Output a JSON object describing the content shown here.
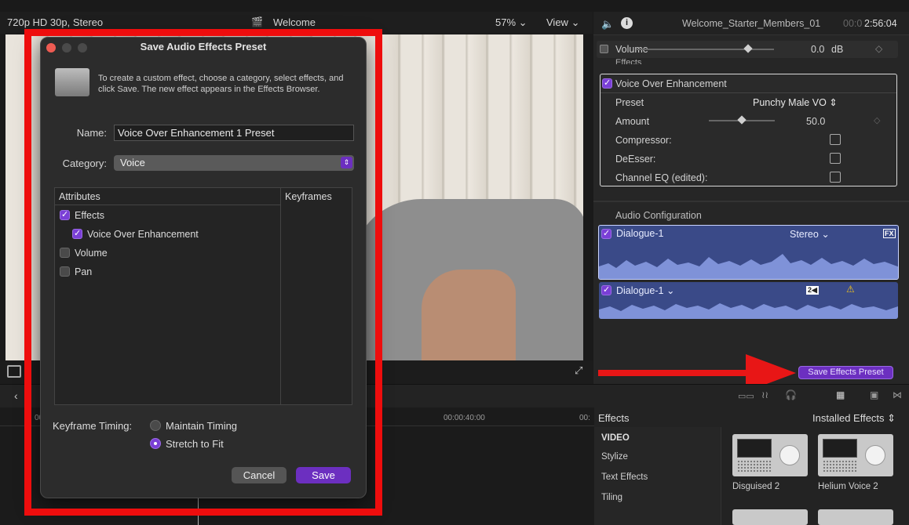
{
  "viewer": {
    "format": "720p HD 30p, Stereo",
    "title": "Welcome",
    "zoom": "57%",
    "view_menu": "View"
  },
  "inspector": {
    "clip_name": "Welcome_Starter_Members_01",
    "timecode_dim": "00:0",
    "timecode": "2:56:04",
    "volume_label": "Volume",
    "volume_value": "0.0",
    "volume_unit": "dB",
    "effects_header": "Effects",
    "effect_name": "Voice Over Enhancement",
    "preset_label": "Preset",
    "preset_value": "Punchy Male VO",
    "amount_label": "Amount",
    "amount_value": "50.0",
    "amount_level": 0.5,
    "compressor_label": "Compressor:",
    "deesser_label": "DeEsser:",
    "channel_eq_label": "Channel EQ (edited):",
    "audio_config_label": "Audio Configuration",
    "clip1_name": "Dialogue-1",
    "clip1_mode": "Stereo",
    "clip1_badge": "FX",
    "clip2_name": "Dialogue-1",
    "clip2_badge": "2◀",
    "warning_icon": "warning-icon",
    "save_preset_button": "Save Effects Preset"
  },
  "timeline": {
    "ruler_time_1": "00:",
    "ruler_time_2": "00:00:40:00",
    "ruler_time_3": "00:"
  },
  "effects_browser": {
    "title": "Effects",
    "installed_label": "Installed Effects",
    "category_header": "VIDEO",
    "categories": [
      "Stylize",
      "Text Effects",
      "Tiling"
    ],
    "thumbs": [
      "Disguised 2",
      "Helium Voice 2"
    ]
  },
  "dialog": {
    "title": "Save Audio Effects Preset",
    "description": "To create a custom effect, choose a category, select effects, and click Save. The new effect appears in the Effects Browser.",
    "name_label": "Name:",
    "name_value": "Voice Over Enhancement 1 Preset",
    "category_label": "Category:",
    "category_value": "Voice",
    "attributes_header": "Attributes",
    "keyframes_header": "Keyframes",
    "attributes": [
      {
        "label": "Effects",
        "checked": true
      },
      {
        "label": "Voice Over Enhancement",
        "checked": true
      },
      {
        "label": "Volume",
        "checked": false
      },
      {
        "label": "Pan",
        "checked": false
      }
    ],
    "keyframe_timing_label": "Keyframe Timing:",
    "maintain_timing": "Maintain Timing",
    "stretch_to_fit": "Stretch to Fit",
    "cancel_label": "Cancel",
    "save_label": "Save"
  },
  "colors": {
    "accent_purple": "#6c2fc0",
    "highlight_red": "#ee0d0d",
    "arrow_red": "#e81616",
    "clip_blue": "#3a4a88"
  }
}
